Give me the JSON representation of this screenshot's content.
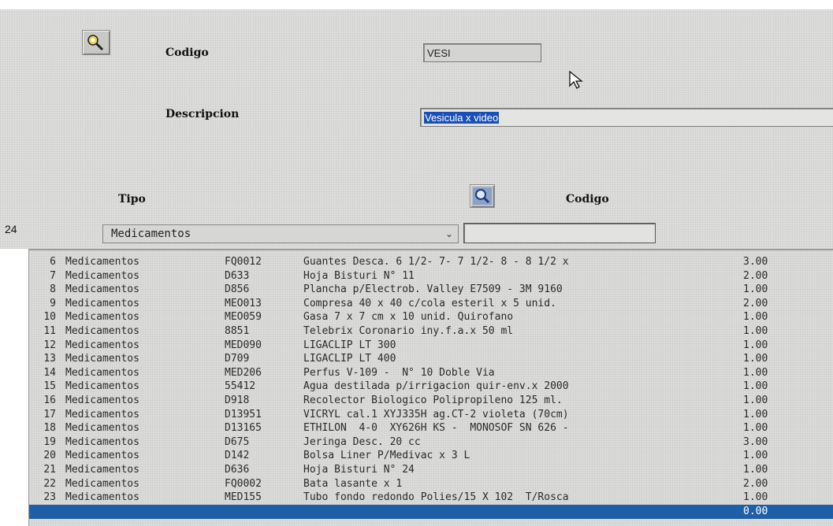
{
  "form": {
    "codigo_label": "Codigo",
    "codigo_value": "VESI",
    "descripcion_label": "Descripcion",
    "descripcion_value": "Vesicula x video",
    "tipo_label": "Tipo",
    "codigo2_label": "Codigo",
    "row_count": "24",
    "tipo_selected": "Medicamentos",
    "icons": {
      "search_top": "key-search-icon",
      "search_mid": "magnifier-icon"
    }
  },
  "grid": {
    "rows": [
      {
        "n": "6",
        "tipo": "Medicamentos",
        "cod": "FQ0012",
        "desc": "Guantes Desca. 6 1/2- 7- 7 1/2- 8 - 8 1/2 x",
        "cant": "3.00"
      },
      {
        "n": "7",
        "tipo": "Medicamentos",
        "cod": "D633",
        "desc": "Hoja Bisturi N° 11",
        "cant": "2.00"
      },
      {
        "n": "8",
        "tipo": "Medicamentos",
        "cod": "D856",
        "desc": "Plancha p/Electrob. Valley E7509 - 3M 9160",
        "cant": "1.00"
      },
      {
        "n": "9",
        "tipo": "Medicamentos",
        "cod": "MEO013",
        "desc": "Compresa 40 x 40 c/cola esteril x 5 unid.",
        "cant": "2.00"
      },
      {
        "n": "10",
        "tipo": "Medicamentos",
        "cod": "MEO059",
        "desc": "Gasa 7 x 7 cm x 10 unid. Quirofano",
        "cant": "1.00"
      },
      {
        "n": "11",
        "tipo": "Medicamentos",
        "cod": "8851",
        "desc": "Telebrix Coronario iny.f.a.x 50 ml",
        "cant": "1.00"
      },
      {
        "n": "12",
        "tipo": "Medicamentos",
        "cod": "MED090",
        "desc": "LIGACLIP LT 300",
        "cant": "1.00"
      },
      {
        "n": "13",
        "tipo": "Medicamentos",
        "cod": "D709",
        "desc": "LIGACLIP LT 400",
        "cant": "1.00"
      },
      {
        "n": "14",
        "tipo": "Medicamentos",
        "cod": "MED206",
        "desc": "Perfus V-109 -  N° 10 Doble Via",
        "cant": "1.00"
      },
      {
        "n": "15",
        "tipo": "Medicamentos",
        "cod": "55412",
        "desc": "Agua destilada p/irrigacion quir-env.x 2000",
        "cant": "1.00"
      },
      {
        "n": "16",
        "tipo": "Medicamentos",
        "cod": "D918",
        "desc": "Recolector Biologico Polipropileno 125 ml.",
        "cant": "1.00"
      },
      {
        "n": "17",
        "tipo": "Medicamentos",
        "cod": "D13951",
        "desc": "VICRYL cal.1 XYJ335H ag.CT-2 violeta (70cm)",
        "cant": "1.00"
      },
      {
        "n": "18",
        "tipo": "Medicamentos",
        "cod": "D13165",
        "desc": "ETHILON  4-0  XY626H KS -  MONOSOF SN 626 -",
        "cant": "1.00"
      },
      {
        "n": "19",
        "tipo": "Medicamentos",
        "cod": "D675",
        "desc": "Jeringa Desc. 20 cc",
        "cant": "3.00"
      },
      {
        "n": "20",
        "tipo": "Medicamentos",
        "cod": "D142",
        "desc": "Bolsa Liner P/Medivac x 3 L",
        "cant": "1.00"
      },
      {
        "n": "21",
        "tipo": "Medicamentos",
        "cod": "D636",
        "desc": "Hoja Bisturi N° 24",
        "cant": "1.00"
      },
      {
        "n": "22",
        "tipo": "Medicamentos",
        "cod": "FQ0002",
        "desc": "Bata lasante x 1",
        "cant": "2.00"
      },
      {
        "n": "23",
        "tipo": "Medicamentos",
        "cod": "MED155",
        "desc": "Tubo fondo redondo Polies/15 X 102  T/Rosca",
        "cant": "1.00"
      },
      {
        "n": "",
        "tipo": "",
        "cod": "",
        "desc": "",
        "cant": "0.00"
      }
    ]
  }
}
